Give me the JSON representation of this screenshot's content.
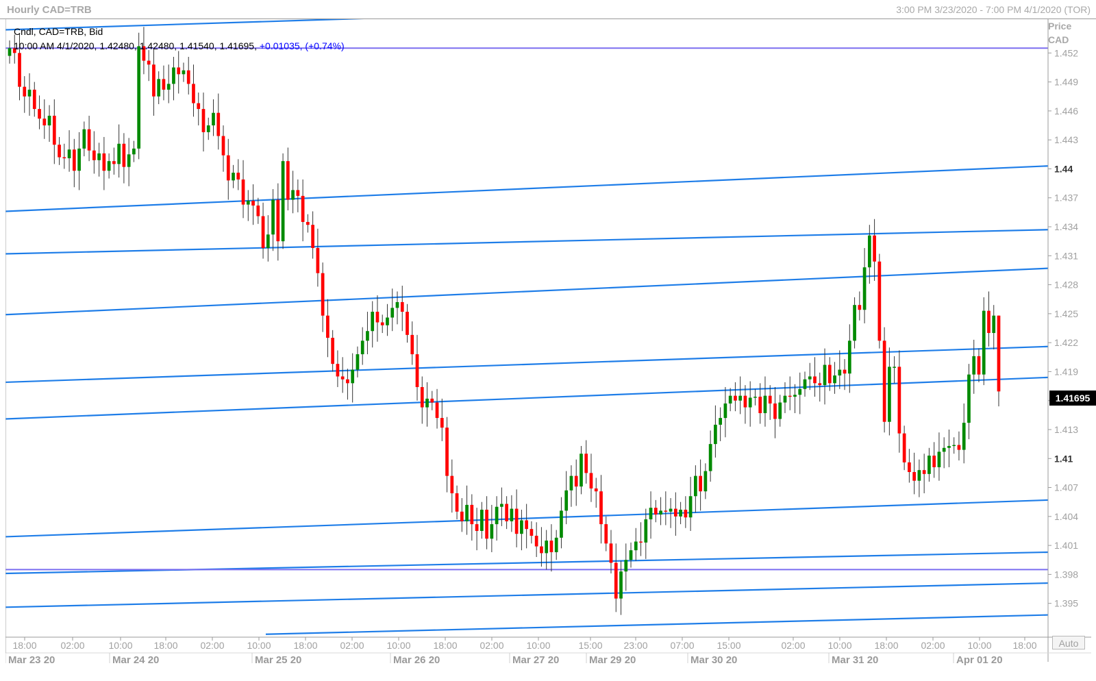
{
  "window": {
    "title_left": "Hourly CAD=TRB",
    "title_right": "3:00 PM 3/23/2020 - 7:00 PM 4/1/2020 (TOR)"
  },
  "legend": {
    "line1": "Cndl, CAD=TRB, Bid",
    "ohlc": "10:00 AM 4/1/2020, 1.42480, 1.42480, 1.41540, 1.41695,",
    "change": "+0.01035, (+0.74%)"
  },
  "price_axis": {
    "header_line1": "Price",
    "header_line2": "CAD",
    "last_price": "1.41695",
    "auto_label": "Auto"
  },
  "colors": {
    "up": "#008a00",
    "down": "#ff0000",
    "trendline": "#1e7de8",
    "horizontal_line": "#7b6ef0",
    "grid_text": "#a0a0a0"
  },
  "chart_data": {
    "type": "candlestick",
    "title": "Hourly CAD=TRB",
    "ylabel": "Price CAD",
    "ylim": [
      1.3915,
      1.4555
    ],
    "y_ticks": [
      "1.452",
      "1.449",
      "1.446",
      "1.443",
      "1.44",
      "1.437",
      "1.434",
      "1.431",
      "1.428",
      "1.425",
      "1.422",
      "1.419",
      "1.416",
      "1.413",
      "1.41",
      "1.407",
      "1.404",
      "1.401",
      "1.398",
      "1.395"
    ],
    "bold_ticks": [
      "1.44",
      "1.41"
    ],
    "x_time_labels": [
      "18:00",
      "02:00",
      "10:00",
      "18:00",
      "02:00",
      "10:00",
      "18:00",
      "02:00",
      "10:00",
      "18:00",
      "02:00",
      "10:00",
      "15:00",
      "23:00",
      "07:00",
      "15:00",
      "02:00",
      "10:00",
      "18:00",
      "02:00",
      "10:00",
      "18:00"
    ],
    "x_date_labels": [
      "Mar 23 20",
      "Mar 24 20",
      "Mar 25 20",
      "Mar 26 20",
      "Mar 27 20",
      "Mar 29 20",
      "Mar 30 20",
      "Mar 31 20",
      "Apr 01 20"
    ],
    "last_candle": {
      "time": "10:00 AM 4/1/2020",
      "open": 1.4248,
      "high": 1.4248,
      "low": 1.4154,
      "close": 1.41695,
      "change": 0.01035,
      "change_pct": 0.74
    },
    "candles_close": [
      1.4525,
      1.452,
      1.4485,
      1.4475,
      1.4482,
      1.4462,
      1.4452,
      1.4445,
      1.4455,
      1.4425,
      1.4412,
      1.4411,
      1.442,
      1.4398,
      1.4421,
      1.4441,
      1.4419,
      1.4409,
      1.4416,
      1.4398,
      1.4408,
      1.4405,
      1.4426,
      1.4402,
      1.4415,
      1.4421,
      1.4527,
      1.4512,
      1.4508,
      1.4475,
      1.4493,
      1.4482,
      1.4488,
      1.4505,
      1.4498,
      1.4502,
      1.4488,
      1.4468,
      1.4462,
      1.4438,
      1.4445,
      1.4458,
      1.4434,
      1.4414,
      1.4388,
      1.4396,
      1.4389,
      1.4363,
      1.4367,
      1.4362,
      1.4351,
      1.4318,
      1.4332,
      1.4368,
      1.4325,
      1.4408,
      1.4368,
      1.4378,
      1.4372,
      1.4345,
      1.4342,
      1.4318,
      1.4292,
      1.4248,
      1.4225,
      1.4198,
      1.4185,
      1.4182,
      1.4178,
      1.4192,
      1.4208,
      1.4222,
      1.4232,
      1.4252,
      1.4241,
      1.4238,
      1.4246,
      1.4256,
      1.4262,
      1.4252,
      1.4228,
      1.4208,
      1.4174,
      1.4153,
      1.4162,
      1.4158,
      1.4142,
      1.4132,
      1.4082,
      1.4064,
      1.4045,
      1.4035,
      1.4052,
      1.4032,
      1.4025,
      1.4047,
      1.4017,
      1.4032,
      1.405,
      1.4053,
      1.4035,
      1.4048,
      1.4022,
      1.4036,
      1.4027,
      1.402,
      1.4009,
      1.4002,
      1.4015,
      1.4003,
      1.4018,
      1.4046,
      1.4067,
      1.4082,
      1.4071,
      1.4105,
      1.4085,
      1.4069,
      1.4066,
      1.4032,
      1.4012,
      1.3992,
      1.3955,
      1.3983,
      1.3995,
      1.4005,
      1.4014,
      1.4013,
      1.4037,
      1.4049,
      1.4042,
      1.4046,
      1.4045,
      1.4048,
      1.404,
      1.4047,
      1.4039,
      1.4061,
      1.4082,
      1.4066,
      1.4087,
      1.4115,
      1.4135,
      1.4142,
      1.4157,
      1.4165,
      1.416,
      1.4165,
      1.4153,
      1.4163,
      1.4164,
      1.4147,
      1.4165,
      1.4157,
      1.4141,
      1.4158,
      1.4165,
      1.4164,
      1.4166,
      1.4172,
      1.4182,
      1.4185,
      1.4178,
      1.4176,
      1.4197,
      1.4178,
      1.4186,
      1.4192,
      1.4188,
      1.4222,
      1.4259,
      1.4254,
      1.4298,
      1.4331,
      1.4304,
      1.4222,
      1.4138,
      1.4195,
      1.4195,
      1.4126,
      1.4096,
      1.4086,
      1.4077,
      1.4088,
      1.4084,
      1.4103,
      1.4091,
      1.4107,
      1.4111,
      1.4113,
      1.4114,
      1.4109,
      1.4137,
      1.4187,
      1.4206,
      1.4187,
      1.4253,
      1.423,
      1.4248,
      1.41695
    ]
  }
}
